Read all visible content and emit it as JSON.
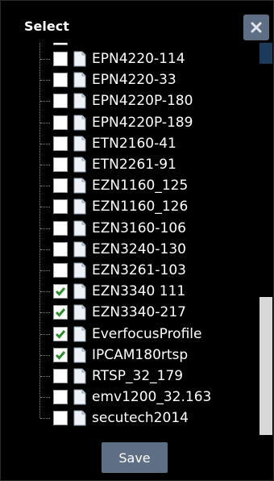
{
  "dialog": {
    "title": "Select",
    "close_icon": "close-icon",
    "save_label": "Save"
  },
  "items": [
    {
      "label": "EPN4220-114",
      "checked": false
    },
    {
      "label": "EPN4220-33",
      "checked": false
    },
    {
      "label": "EPN4220P-180",
      "checked": false
    },
    {
      "label": "EPN4220P-189",
      "checked": false
    },
    {
      "label": "ETN2160-41",
      "checked": false
    },
    {
      "label": "ETN2261-91",
      "checked": false
    },
    {
      "label": "EZN1160_125",
      "checked": false
    },
    {
      "label": "EZN1160_126",
      "checked": false
    },
    {
      "label": "EZN3160-106",
      "checked": false
    },
    {
      "label": "EZN3240-130",
      "checked": false
    },
    {
      "label": "EZN3261-103",
      "checked": false
    },
    {
      "label": "EZN3340 111",
      "checked": true
    },
    {
      "label": "EZN3340-217",
      "checked": true
    },
    {
      "label": "EverfocusProfile",
      "checked": true
    },
    {
      "label": "IPCAM180rtsp",
      "checked": true
    },
    {
      "label": "RTSP_32_179",
      "checked": false
    },
    {
      "label": "emv1200_32.163",
      "checked": false
    },
    {
      "label": "secutech2014",
      "checked": false
    }
  ],
  "colors": {
    "background": "#000000",
    "button": "#5e6f85",
    "check": "#2e8b2e",
    "text": "#ffffff"
  }
}
